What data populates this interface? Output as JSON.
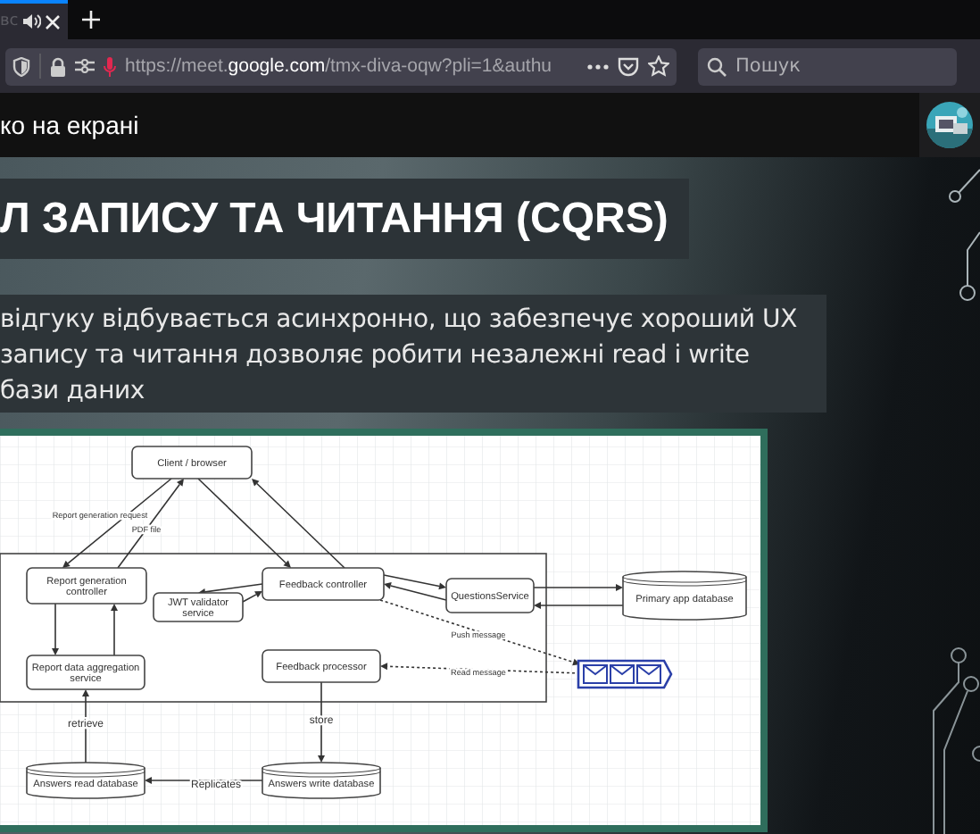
{
  "browser": {
    "tab": {
      "title": "вс"
    },
    "address_bar": {
      "url": "https://meet.**google.com**/tmx-diva-oqw?pli=1&authu"
    },
    "search": {
      "placeholder": "Пошук"
    }
  },
  "meet": {
    "presentation_label": "ко на екрані"
  },
  "slide": {
    "title": "Л ЗАПИСУ ТА ЧИТАННЯ (CQRS)",
    "body_lines": [
      "відгуку відбувається асинхронно, що забезпечує хороший UX",
      "запису та читання дозволяє робити незалежні read і write",
      "бази даних"
    ],
    "diagram": {
      "nodes": [
        {
          "kind": "box",
          "lines": [
            "Client / browser"
          ]
        },
        {
          "kind": "box",
          "lines": [
            "Report generation",
            "controller"
          ]
        },
        {
          "kind": "box",
          "lines": [
            "JWT validator",
            "service"
          ]
        },
        {
          "kind": "box",
          "lines": [
            "Feedback controller"
          ]
        },
        {
          "kind": "box",
          "lines": [
            "QuestionsService"
          ]
        },
        {
          "kind": "database",
          "lines": [
            "Primary app database"
          ]
        },
        {
          "kind": "box",
          "lines": [
            "Report data aggregation",
            "service"
          ]
        },
        {
          "kind": "box",
          "lines": [
            "Feedback processor"
          ]
        },
        {
          "kind": "database",
          "lines": [
            "Answers read database"
          ]
        },
        {
          "kind": "database",
          "lines": [
            "Answers write database"
          ]
        }
      ],
      "edge_labels": [
        "Report generation request",
        "PDF file",
        "Push message",
        "Read message",
        "retrieve",
        "store",
        "Replicates"
      ]
    }
  }
}
